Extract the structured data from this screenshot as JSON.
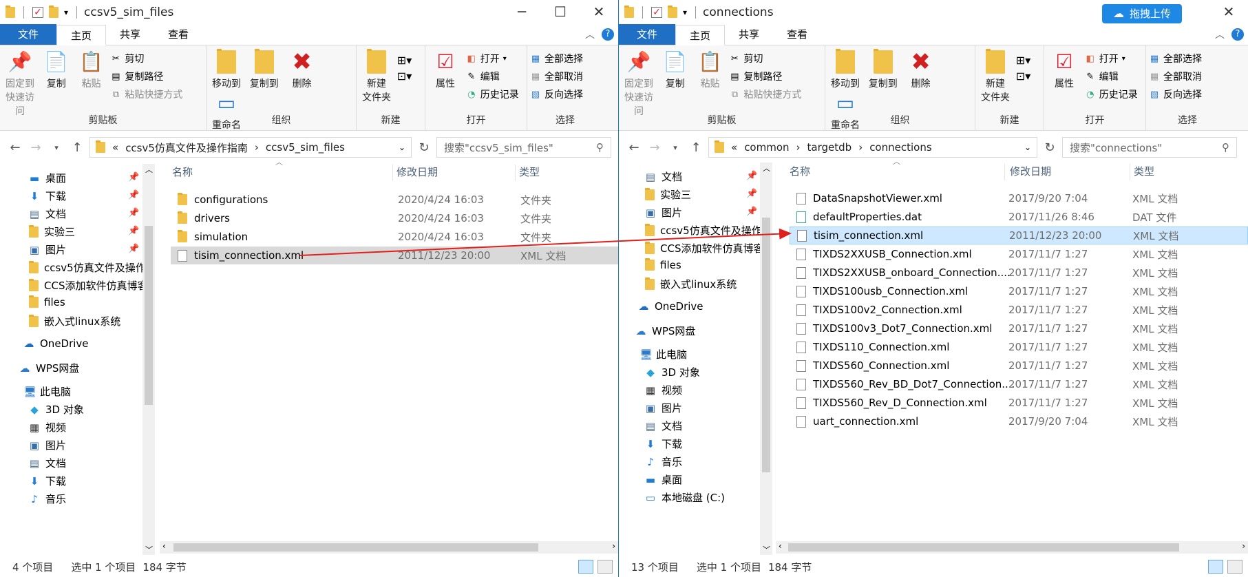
{
  "left": {
    "title": "ccsv5_sim_files",
    "tabs": {
      "file": "文件",
      "home": "主页",
      "share": "共享",
      "view": "查看"
    },
    "ribbon": {
      "clipboard": {
        "name": "剪贴板",
        "pin": "固定到\n快速访问",
        "copy": "复制",
        "paste": "粘贴",
        "cut": "剪切",
        "copy_path": "复制路径",
        "paste_shortcut": "粘贴快捷方式"
      },
      "organize": {
        "name": "组织",
        "move_to": "移动到",
        "copy_to": "复制到",
        "delete": "删除",
        "rename": "重命名"
      },
      "new": {
        "name": "新建",
        "new_folder": "新建\n文件夹"
      },
      "open": {
        "name": "打开",
        "properties": "属性",
        "open": "打开",
        "edit": "编辑",
        "history": "历史记录"
      },
      "select": {
        "name": "选择",
        "select_all": "全部选择",
        "select_none": "全部取消",
        "invert": "反向选择"
      }
    },
    "address": {
      "crumbs": [
        "«",
        "ccsv5仿真文件及操作指南",
        "›",
        "ccsv5_sim_files"
      ],
      "search_placeholder": "搜索\"ccsv5_sim_files\""
    },
    "nav": [
      "桌面",
      "下载",
      "文档",
      "实验三",
      "图片",
      "ccsv5仿真文件及操作",
      "CCS添加软件仿真博客",
      "files",
      "嵌入式linux系统",
      "OneDrive",
      "WPS网盘",
      "此电脑",
      "3D 对象",
      "视频",
      "图片",
      "文档",
      "下载",
      "音乐"
    ],
    "columns": {
      "name": "名称",
      "date": "修改日期",
      "type": "类型"
    },
    "files": [
      {
        "name": "configurations",
        "date": "2020/4/24 16:03",
        "type": "文件夹"
      },
      {
        "name": "drivers",
        "date": "2020/4/24 16:03",
        "type": "文件夹"
      },
      {
        "name": "simulation",
        "date": "2020/4/24 16:03",
        "type": "文件夹"
      },
      {
        "name": "tisim_connection.xml",
        "date": "2011/12/23 20:00",
        "type": "XML 文档"
      }
    ],
    "status": {
      "count": "4 个项目",
      "selected": "选中 1 个项目",
      "size": "184 字节"
    }
  },
  "right": {
    "title": "connections",
    "upload_label": "拖拽上传",
    "tabs": {
      "file": "文件",
      "home": "主页",
      "share": "共享",
      "view": "查看"
    },
    "ribbon": {
      "clipboard": {
        "name": "剪贴板",
        "pin": "固定到\n快速访问",
        "copy": "复制",
        "paste": "粘贴",
        "cut": "剪切",
        "copy_path": "复制路径",
        "paste_shortcut": "粘贴快捷方式"
      },
      "organize": {
        "name": "组织",
        "move_to": "移动到",
        "copy_to": "复制到",
        "delete": "删除",
        "rename": "重命名"
      },
      "new": {
        "name": "新建",
        "new_folder": "新建\n文件夹"
      },
      "open": {
        "name": "打开",
        "properties": "属性",
        "open": "打开",
        "edit": "编辑",
        "history": "历史记录"
      },
      "select": {
        "name": "选择",
        "select_all": "全部选择",
        "select_none": "全部取消",
        "invert": "反向选择"
      }
    },
    "address": {
      "crumbs": [
        "«",
        "common",
        "›",
        "targetdb",
        "›",
        "connections"
      ],
      "search_placeholder": "搜索\"connections\""
    },
    "nav": [
      "文档",
      "实验三",
      "图片",
      "ccsv5仿真文件及操作",
      "CCS添加软件仿真博客",
      "files",
      "嵌入式linux系统",
      "OneDrive",
      "WPS网盘",
      "此电脑",
      "3D 对象",
      "视频",
      "图片",
      "文档",
      "下载",
      "音乐",
      "桌面",
      "本地磁盘 (C:)"
    ],
    "columns": {
      "name": "名称",
      "date": "修改日期",
      "type": "类型"
    },
    "files": [
      {
        "name": "DataSnapshotViewer.xml",
        "date": "2017/9/20 7:04",
        "type": "XML 文档"
      },
      {
        "name": "defaultProperties.dat",
        "date": "2017/11/26 8:46",
        "type": "DAT 文件"
      },
      {
        "name": "tisim_connection.xml",
        "date": "2011/12/23 20:00",
        "type": "XML 文档"
      },
      {
        "name": "TIXDS2XXUSB_Connection.xml",
        "date": "2017/11/7 1:27",
        "type": "XML 文档"
      },
      {
        "name": "TIXDS2XXUSB_onboard_Connection....",
        "date": "2017/11/7 1:27",
        "type": "XML 文档"
      },
      {
        "name": "TIXDS100usb_Connection.xml",
        "date": "2017/11/7 1:27",
        "type": "XML 文档"
      },
      {
        "name": "TIXDS100v2_Connection.xml",
        "date": "2017/11/7 1:27",
        "type": "XML 文档"
      },
      {
        "name": "TIXDS100v3_Dot7_Connection.xml",
        "date": "2017/11/7 1:27",
        "type": "XML 文档"
      },
      {
        "name": "TIXDS110_Connection.xml",
        "date": "2017/11/7 1:27",
        "type": "XML 文档"
      },
      {
        "name": "TIXDS560_Connection.xml",
        "date": "2017/11/7 1:27",
        "type": "XML 文档"
      },
      {
        "name": "TIXDS560_Rev_BD_Dot7_Connection....",
        "date": "2017/11/7 1:27",
        "type": "XML 文档"
      },
      {
        "name": "TIXDS560_Rev_D_Connection.xml",
        "date": "2017/11/7 1:27",
        "type": "XML 文档"
      },
      {
        "name": "uart_connection.xml",
        "date": "2017/9/20 7:04",
        "type": "XML 文档"
      }
    ],
    "status": {
      "count": "13 个项目",
      "selected": "选中 1 个项目",
      "size": "184 字节"
    }
  }
}
